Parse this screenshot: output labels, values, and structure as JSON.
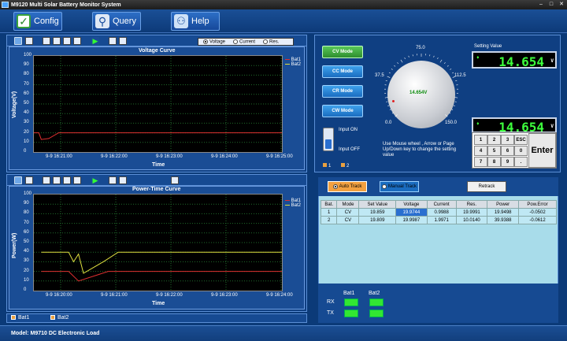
{
  "window": {
    "title": "M9120 Multi Solar Battery Monitor System"
  },
  "toolbar": {
    "config": "Config",
    "query": "Query",
    "help": "Help"
  },
  "voltage_chart": {
    "title": "Voltage Curve",
    "radio": {
      "voltage": "Voltage",
      "current": "Current",
      "res": "Res."
    },
    "ylabel": "Voltage(V)",
    "xlabel": "Time",
    "yticks": [
      "100",
      "90",
      "80",
      "70",
      "60",
      "50",
      "40",
      "30",
      "20",
      "10",
      "0"
    ],
    "xticks": [
      "9-9 16:21:00",
      "9-9 16:22:00",
      "9-9 16:23:00",
      "9-9 16:24:00",
      "9-9 16:25:00"
    ],
    "legend": [
      "Bat1",
      "Bat2"
    ]
  },
  "power_chart": {
    "title": "Power-Time Curve",
    "ylabel": "Power(W)",
    "xlabel": "Time",
    "yticks": [
      "100",
      "90",
      "80",
      "70",
      "60",
      "50",
      "40",
      "30",
      "20",
      "10",
      "0"
    ],
    "xticks": [
      "9-9 16:20:00",
      "9-9 16:21:00",
      "9-9 16:22:00",
      "9-9 16:23:00",
      "9-9 16:24:00"
    ],
    "legend": [
      "Bat1",
      "Bat2"
    ]
  },
  "bottom_tabs": {
    "bat1": "Bat1",
    "bat2": "Bat2"
  },
  "modes": {
    "cv": "CV Mode",
    "cc": "CC Mode",
    "cr": "CR Mode",
    "cw": "CW Mode"
  },
  "dial": {
    "value": "14.654V",
    "scale": [
      "75.0",
      "37.5",
      "112.5",
      "0.0",
      "150.0"
    ]
  },
  "setting": {
    "label": "Setting Value",
    "lcd1": "14.654",
    "lcd2": "14.654",
    "unit": "V"
  },
  "input": {
    "on": "Input ON",
    "off": "Input OFF"
  },
  "hint": "Use Mouse wheel , Arrow or Page Up/Down key to change the setting value",
  "channel_sel": {
    "c1": "1",
    "c2": "2"
  },
  "keypad": {
    "keys": [
      "1",
      "2",
      "3",
      "ESC",
      "4",
      "5",
      "6",
      "0",
      "7",
      "8",
      "9",
      "."
    ],
    "enter": "Enter"
  },
  "track": {
    "auto": "Auto Track",
    "manual": "Manual Track",
    "retrack": "Retrack"
  },
  "table": {
    "headers": [
      "Bat.",
      "Mode",
      "Set Value",
      "Voltage",
      "Current",
      "Res.",
      "Power",
      "Pow.Error"
    ],
    "rows": [
      [
        "1",
        "CV",
        "19.859",
        "19.9744",
        "0.9988",
        "19.9991",
        "19.9498",
        "-0.0502"
      ],
      [
        "2",
        "CV",
        "19.809",
        "19.9987",
        "1.9971",
        "10.0140",
        "39.9388",
        "-0.0612"
      ]
    ]
  },
  "comm": {
    "bat1": "Bat1",
    "bat2": "Bat2",
    "rx": "RX",
    "tx": "TX"
  },
  "status": {
    "model": "Model: M9710 DC Electronic Load"
  },
  "chart_data": [
    {
      "type": "line",
      "title": "Voltage Curve",
      "xlabel": "Time",
      "ylabel": "Voltage(V)",
      "ylim": [
        0,
        100
      ],
      "x": [
        "9-9 16:21:00",
        "9-9 16:22:00",
        "9-9 16:23:00",
        "9-9 16:24:00",
        "9-9 16:25:00"
      ],
      "series": [
        {
          "name": "Bat1",
          "color": "#e03030",
          "points": [
            [
              0,
              20
            ],
            [
              0.02,
              20
            ],
            [
              0.03,
              13
            ],
            [
              0.06,
              14
            ],
            [
              0.1,
              20
            ],
            [
              0.6,
              20
            ],
            [
              1,
              20
            ]
          ]
        },
        {
          "name": "Bat2",
          "color": "#e0e040",
          "points": []
        }
      ]
    },
    {
      "type": "line",
      "title": "Power-Time Curve",
      "xlabel": "Time",
      "ylabel": "Power(W)",
      "ylim": [
        0,
        100
      ],
      "x": [
        "9-9 16:20:00",
        "9-9 16:21:00",
        "9-9 16:22:00",
        "9-9 16:23:00",
        "9-9 16:24:00"
      ],
      "series": [
        {
          "name": "Bat1",
          "color": "#e03030",
          "points": [
            [
              0.03,
              20
            ],
            [
              0.14,
              20
            ],
            [
              0.18,
              10
            ],
            [
              0.3,
              20
            ],
            [
              0.6,
              20
            ],
            [
              1,
              20
            ]
          ]
        },
        {
          "name": "Bat2",
          "color": "#e0e040",
          "points": [
            [
              0.03,
              40
            ],
            [
              0.14,
              40
            ],
            [
              0.16,
              30
            ],
            [
              0.18,
              38
            ],
            [
              0.2,
              18
            ],
            [
              0.28,
              30
            ],
            [
              0.34,
              40
            ],
            [
              0.6,
              40
            ],
            [
              1,
              40
            ]
          ]
        }
      ]
    }
  ]
}
